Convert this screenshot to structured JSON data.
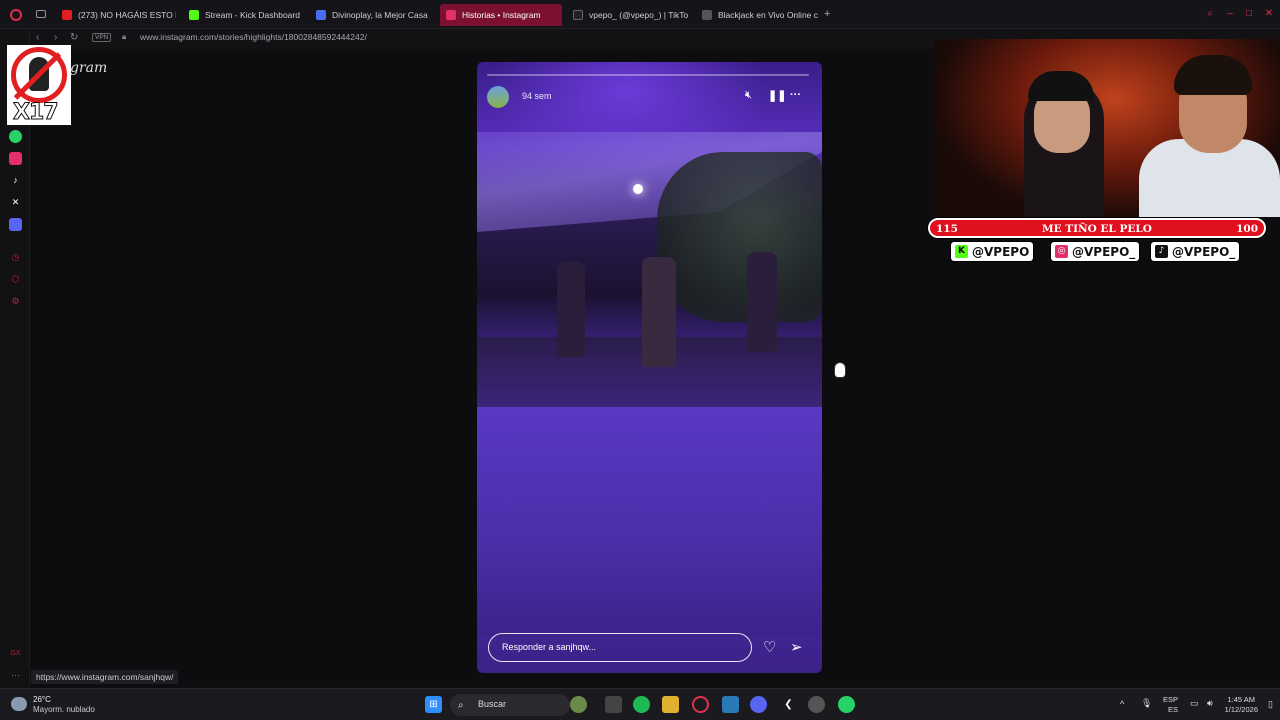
{
  "browser": {
    "tabs": [
      {
        "label": "(273) NO HAGÁIS ESTO E",
        "color": "#e02020"
      },
      {
        "label": "Stream - Kick Dashboard",
        "color": "#53fc18"
      },
      {
        "label": "Divinoplay, la Mejor Casa",
        "color": "#4a6cf0"
      },
      {
        "label": "Historias • Instagram",
        "color": "#e1306c"
      },
      {
        "label": "vpepo_ (@vpepo_) | TikTo",
        "color": "#222222"
      },
      {
        "label": "Blackjack en Vivo Online c",
        "color": "#3a3a3a"
      }
    ],
    "new_tab": "+",
    "url": "www.instagram.com/stories/highlights/18002848592444242/",
    "vpn": "VPN"
  },
  "story": {
    "time_ago": "94 sem",
    "reply_placeholder": "Responder a sanjhqw...",
    "icons": [
      "mute-icon",
      "pause-icon",
      "more-icon",
      "heart-icon",
      "send-icon"
    ]
  },
  "instagram_logo_text": "gram",
  "watermark": {
    "text": "X17"
  },
  "overlay": {
    "banner_left": "115",
    "banner_title": "ME TIÑO EL PELO",
    "banner_right": "100",
    "socials": [
      {
        "label": "@VPEPO",
        "icon": "kick-icon",
        "color": "#53fc18"
      },
      {
        "label": "@VPEPO_",
        "icon": "instagram-icon",
        "color": "#e1306c"
      },
      {
        "label": "@VPEPO_",
        "icon": "tiktok-icon",
        "color": "#111111"
      }
    ]
  },
  "status_link": "https://www.instagram.com/sanjhqw/",
  "taskbar": {
    "temperature": "26°C",
    "weather": "Mayorm. nublado",
    "search": "Buscar",
    "lang_top": "ESP",
    "lang_bottom": "ES",
    "time": "1:45 AM",
    "date": "1/12/2026"
  }
}
